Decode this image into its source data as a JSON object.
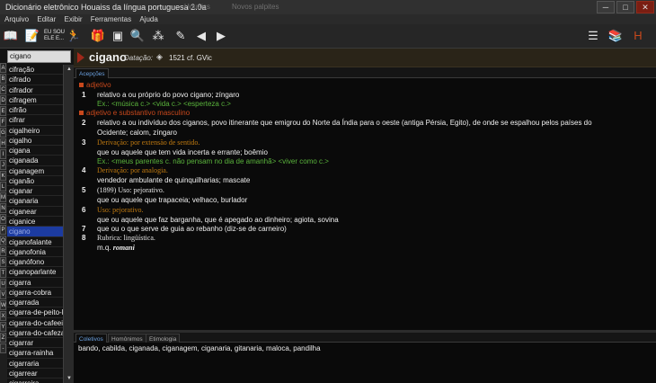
{
  "window": {
    "title": "Dicionário eletrônico Houaiss da língua portuguesa 2.0a",
    "ghost_tab_1": "Houaiss",
    "ghost_tab_2": "Novos palpites",
    "min": "─",
    "max": "□",
    "close": "✕"
  },
  "menu": [
    "Arquivo",
    "Editar",
    "Exibir",
    "Ferramentas",
    "Ajuda"
  ],
  "toolbar": {
    "vocab_label": "EU SOU\nELE E...",
    "icons": [
      "book-icon",
      "note-icon",
      "vocabulary-icon",
      "person-run-icon",
      "gift-icon",
      "camera-icon",
      "magnifier-icon",
      "dots-icon",
      "pencil-icon",
      "back-icon",
      "forward-icon",
      "list-view-icon",
      "books-icon",
      "houaiss-logo-icon"
    ],
    "back_glyph": "◀",
    "forward_glyph": "▶"
  },
  "search": {
    "value": "cigano"
  },
  "alphabet": [
    "A",
    "B",
    "C",
    "D",
    "E",
    "F",
    "G",
    "H",
    "I",
    "J",
    "K",
    "L",
    "M",
    "N",
    "O",
    "P",
    "Q",
    "R",
    "S",
    "T",
    "U",
    "V",
    "W",
    "X",
    "Y",
    "Z",
    "-"
  ],
  "wordlist": {
    "items": [
      "cifração",
      "cifrado",
      "cifrador",
      "cifragem",
      "cifrão",
      "cifrar",
      "cigalheiro",
      "cigalho",
      "cigana",
      "ciganada",
      "ciganagem",
      "ciganão",
      "ciganar",
      "ciganaria",
      "ciganear",
      "ciganice",
      "cigano",
      "ciganofalante",
      "ciganofonia",
      "ciganófono",
      "ciganoparlante",
      "cigarra",
      "cigarra-cobra",
      "cigarrada",
      "cigarra-de-peito-b",
      "cigarra-do-cafeeir",
      "cigarra-do-cafeza",
      "cigarrar",
      "cigarra-rainha",
      "cigarraria",
      "cigarrear",
      "cigarreira"
    ],
    "selected": "cigano"
  },
  "entry": {
    "word": "cigano",
    "date_label": "Datação:",
    "date_value": "1521 cf. GVic",
    "tabs_top": [
      "Acepções"
    ],
    "section1": "adjetivo",
    "s1_num": "1",
    "s1_def": "relativo a ou próprio do povo cigano; zíngaro",
    "s1_ex": "Ex.: <música c.> <vida c.> <esperteza c.>",
    "section2": "adjetivo e substantivo masculino",
    "s2_num": "2",
    "s2_def_a": "relativo a ou indivíduo dos ciganos, povo itinerante que emigrou do Norte da Índia para o oeste (antiga Pérsia, Egito), de onde se espalhou pelos países do",
    "s2_def_b": "Ocidente; calom, zíngaro",
    "s3_num": "3",
    "s3_label": "Derivação: por extensão de sentido.",
    "s3_def": "que ou aquele que tem vida incerta e errante; boêmio",
    "s3_ex": "Ex.: <meus parentes c. não pensam no dia de amanhã> <viver como c.>",
    "s4_num": "4",
    "s4_label": "Derivação: por analogia.",
    "s4_def": "vendedor ambulante de quinquilharias; mascate",
    "s5_num": "5",
    "s5_label": "(1899) Uso: pejorativo.",
    "s5_def": "que ou aquele que trapaceia; velhaco, burlador",
    "s6_num": "6",
    "s6_label": "Uso: pejorativo.",
    "s6_def": "que ou aquele que faz barganha, que é apegado ao dinheiro; agiota, sovina",
    "s7_num": "7",
    "s7_def": "que ou o que serve de guia ao rebanho (diz-se de carneiro)",
    "s8_num": "8",
    "s8_label": "Rubrica: lingüística.",
    "s8_def_a": "m.q.",
    "s8_def_b": "romani"
  },
  "bottom": {
    "tabs": [
      "Coletivos",
      "Homônimos",
      "Etimologia"
    ],
    "active_tab": "Coletivos",
    "text": "bando, cabilda, ciganada, ciganagem, ciganaria, gitanaria, maloca, pandilha"
  },
  "colors": {
    "selection": "#1c3ba0",
    "section": "#c8481c",
    "example": "#5ab43c",
    "label": "#c07a10"
  }
}
